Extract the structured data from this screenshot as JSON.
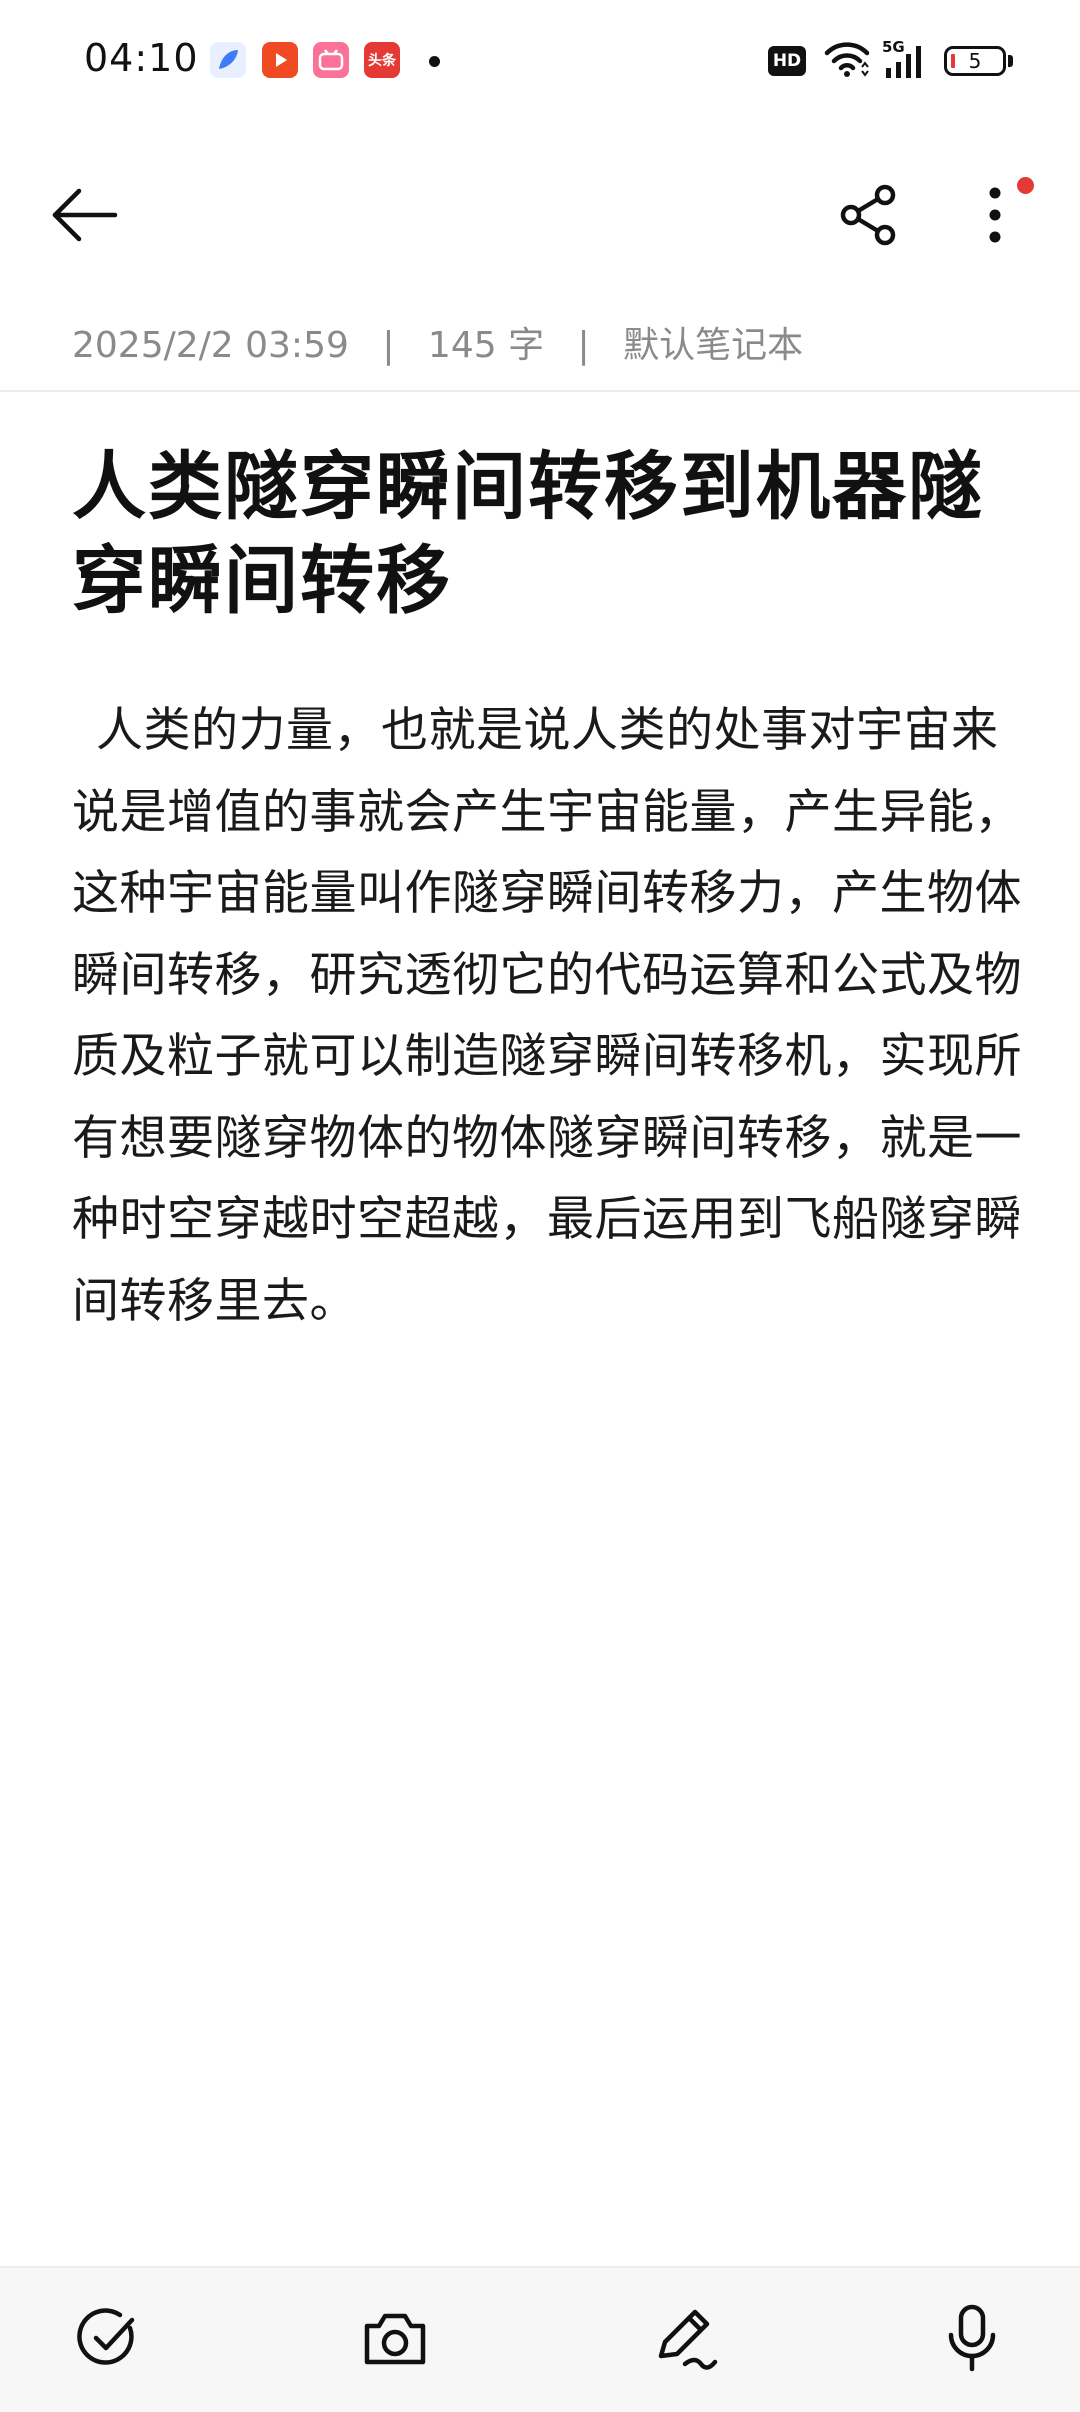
{
  "status_bar": {
    "time": "04:10",
    "notification_icons": [
      "feather-app-icon",
      "video-play-app-icon",
      "bilibili-app-icon",
      "toutiao-app-icon"
    ],
    "toutiao_label": "头条",
    "hd_label": "HD",
    "network_label": "5G",
    "battery_level": "5",
    "colors": {
      "video_app": "#f04a22",
      "bilibili_app": "#fb7299",
      "toutiao_app": "#e53935",
      "feather_app": "#3d7bf7",
      "battery_low": "#e53935"
    }
  },
  "toolbar": {
    "back_icon": "arrow-left-icon",
    "share_icon": "share-icon",
    "more_icon": "more-vertical-icon",
    "has_more_badge": true
  },
  "meta": {
    "datetime": "2025/2/2 03:59",
    "word_count": "145 字",
    "notebook": "默认笔记本",
    "separator": "|"
  },
  "note": {
    "title": "人类隧穿瞬间转移到机器隧穿瞬间转移",
    "body": "人类的力量，也就是说人类的处事对宇宙来说是增值的事就会产生宇宙能量，产生异能，这种宇宙能量叫作隧穿瞬间转移力，产生物体瞬间转移，研究透彻它的代码运算和公式及物质及粒子就可以制造隧穿瞬间转移机，实现所有想要隧穿物体的物体隧穿瞬间转移，就是一种时空穿越时空超越，最后运用到飞船隧穿瞬间转移里去。"
  },
  "bottom_bar": {
    "icons": [
      "checklist-icon",
      "camera-icon",
      "pen-icon",
      "microphone-icon"
    ]
  }
}
